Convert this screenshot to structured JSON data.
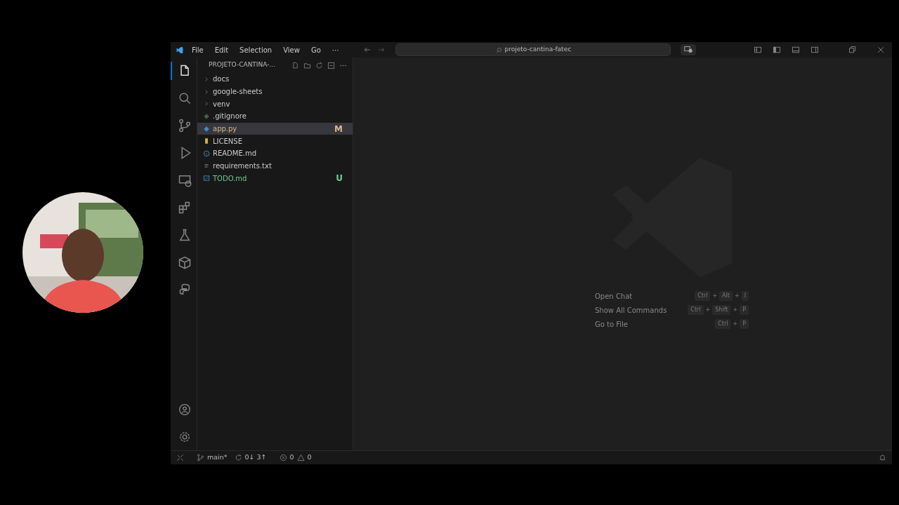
{
  "menu": [
    "File",
    "Edit",
    "Selection",
    "View",
    "Go",
    "···"
  ],
  "search": {
    "value": "projeto-cantina-fatec"
  },
  "activity_bar": [
    {
      "kind": "files",
      "selected": true
    },
    {
      "kind": "search",
      "selected": false
    },
    {
      "kind": "source-control",
      "selected": false
    },
    {
      "kind": "run",
      "selected": false
    },
    {
      "kind": "remote",
      "selected": false
    },
    {
      "kind": "extensions",
      "selected": false
    },
    {
      "kind": "testing",
      "selected": false
    },
    {
      "kind": "box",
      "selected": false
    },
    {
      "kind": "python",
      "selected": false
    }
  ],
  "explorer": {
    "title": "PROJETO-CANTINA-...",
    "items": [
      {
        "label": "docs",
        "kind": "folder",
        "expanded": false,
        "selected": false
      },
      {
        "label": "google-sheets",
        "kind": "folder",
        "expanded": false,
        "selected": false
      },
      {
        "label": "venv",
        "kind": "folder",
        "expanded": false,
        "selected": false
      },
      {
        "label": ".gitignore",
        "kind": "git",
        "selected": false
      },
      {
        "label": "app.py",
        "kind": "python",
        "selected": true,
        "status": "M",
        "color": "#d7b98a"
      },
      {
        "label": "LICENSE",
        "kind": "license",
        "selected": false
      },
      {
        "label": "README.md",
        "kind": "info",
        "selected": false
      },
      {
        "label": "requirements.txt",
        "kind": "text",
        "selected": false
      },
      {
        "label": "TODO.md",
        "kind": "todo",
        "selected": false,
        "status": "U",
        "color": "#73c991"
      }
    ]
  },
  "shortcuts": [
    {
      "label": "Open Chat",
      "keys": [
        "Ctrl",
        "+",
        "Alt",
        "+",
        "I"
      ]
    },
    {
      "label": "Show All Commands",
      "keys": [
        "Ctrl",
        "+",
        "Shift",
        "+",
        "P"
      ]
    },
    {
      "label": "Go to File",
      "keys": [
        "Ctrl",
        "+",
        "P"
      ]
    }
  ],
  "status_bar": {
    "branch": "main*",
    "sync": "0↓ 3↑",
    "errors": "0",
    "warnings": "0"
  }
}
